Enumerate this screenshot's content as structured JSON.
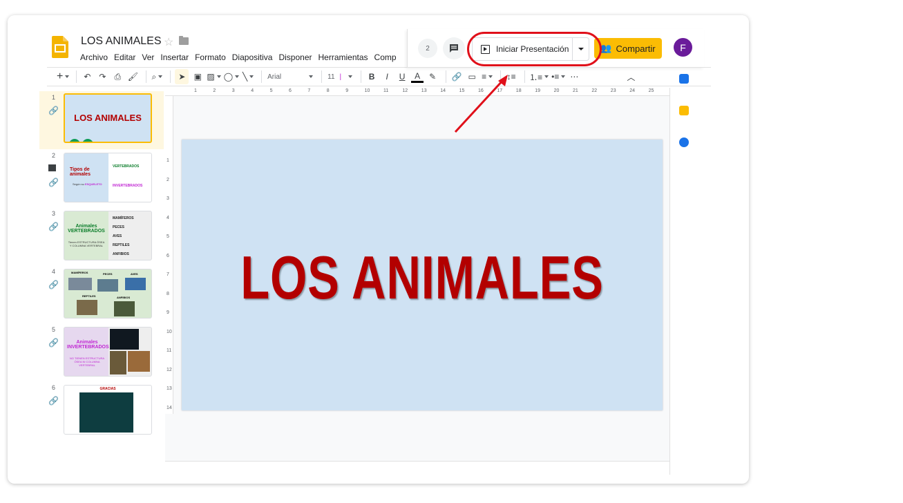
{
  "doc": {
    "title": "LOS ANIMALES"
  },
  "menu": [
    "Archivo",
    "Editar",
    "Ver",
    "Insertar",
    "Formato",
    "Diapositiva",
    "Disponer",
    "Herramientas",
    "Comp"
  ],
  "header": {
    "viewers_count": "2",
    "present_label": "Iniciar Presentación",
    "share_label": "Compartir",
    "avatar_letter": "F"
  },
  "toolbar": {
    "font": "Arial",
    "size": "11"
  },
  "ruler": {
    "top": [
      "1",
      "2",
      "3",
      "4",
      "5",
      "6",
      "7",
      "8",
      "9",
      "10",
      "11",
      "12",
      "13",
      "14",
      "15",
      "16",
      "17",
      "18",
      "19",
      "20",
      "21",
      "22",
      "23",
      "24",
      "25"
    ],
    "left": [
      "1",
      "2",
      "3",
      "4",
      "5",
      "6",
      "7",
      "8",
      "9",
      "10",
      "11",
      "12",
      "13",
      "14"
    ]
  },
  "slides": [
    {
      "num": "1",
      "title": "LOS ANIMALES"
    },
    {
      "num": "2",
      "title": "Tipos de animales",
      "sub": "Según su",
      "sub_strong": "ESQUELETO",
      "a": "VERTEBRADOS",
      "b": "INVERTEBRADOS"
    },
    {
      "num": "3",
      "title": "Animales VERTEBRADOS",
      "sub": "Tienen ESTRUCTURA ÓSEA Y COLUMNA VERTEBRAL",
      "items": [
        "MAMÍFEROS",
        "PECES",
        "AVES",
        "REPTILES",
        "ANFIBIOS"
      ]
    },
    {
      "num": "4",
      "labels": [
        "MAMÍFEROS",
        "PECES",
        "AVES",
        "REPTILES",
        "ANFIBIOS"
      ]
    },
    {
      "num": "5",
      "title": "Animales INVERTEBRADOS",
      "sub": "NO TIENEN ESTRUCTURA ÓSEA NI COLUMNA VERTEBRAL"
    },
    {
      "num": "6",
      "title": "GRACIAS"
    }
  ],
  "main_slide": {
    "title": "LOS ANIMALES"
  },
  "colors": {
    "accent": "#fbbc04",
    "slide_bg": "#cfe2f3",
    "title_red": "#b30000",
    "highlight": "#e0101a"
  }
}
